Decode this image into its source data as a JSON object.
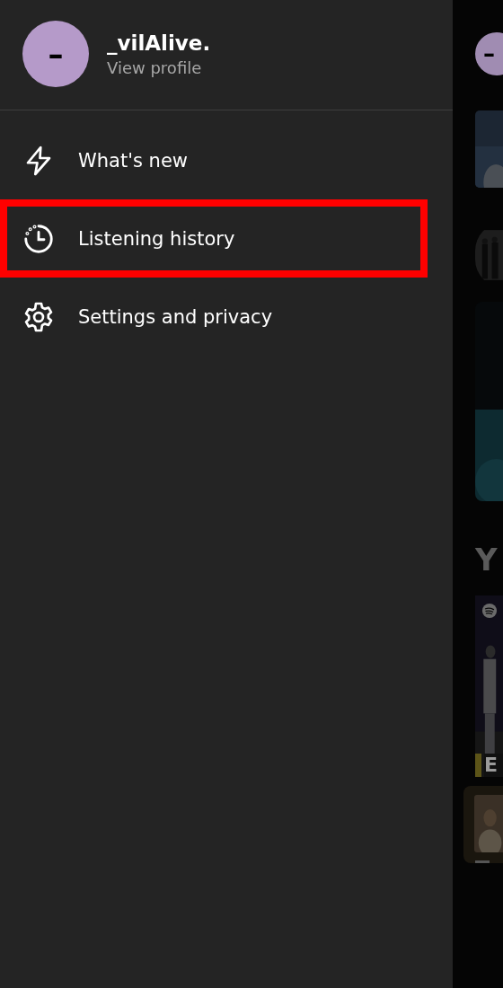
{
  "profile": {
    "avatar_letter": "–",
    "name": "_vilAlive.",
    "link": "View profile"
  },
  "menu": [
    {
      "label": "What's new",
      "kind": "whatsnew",
      "highlighted": false
    },
    {
      "label": "Listening history",
      "kind": "history",
      "highlighted": true
    },
    {
      "label": "Settings and privacy",
      "kind": "settings",
      "highlighted": false
    }
  ],
  "background": {
    "avatar_letter": "–",
    "heading": "Y",
    "card_label": "E"
  }
}
